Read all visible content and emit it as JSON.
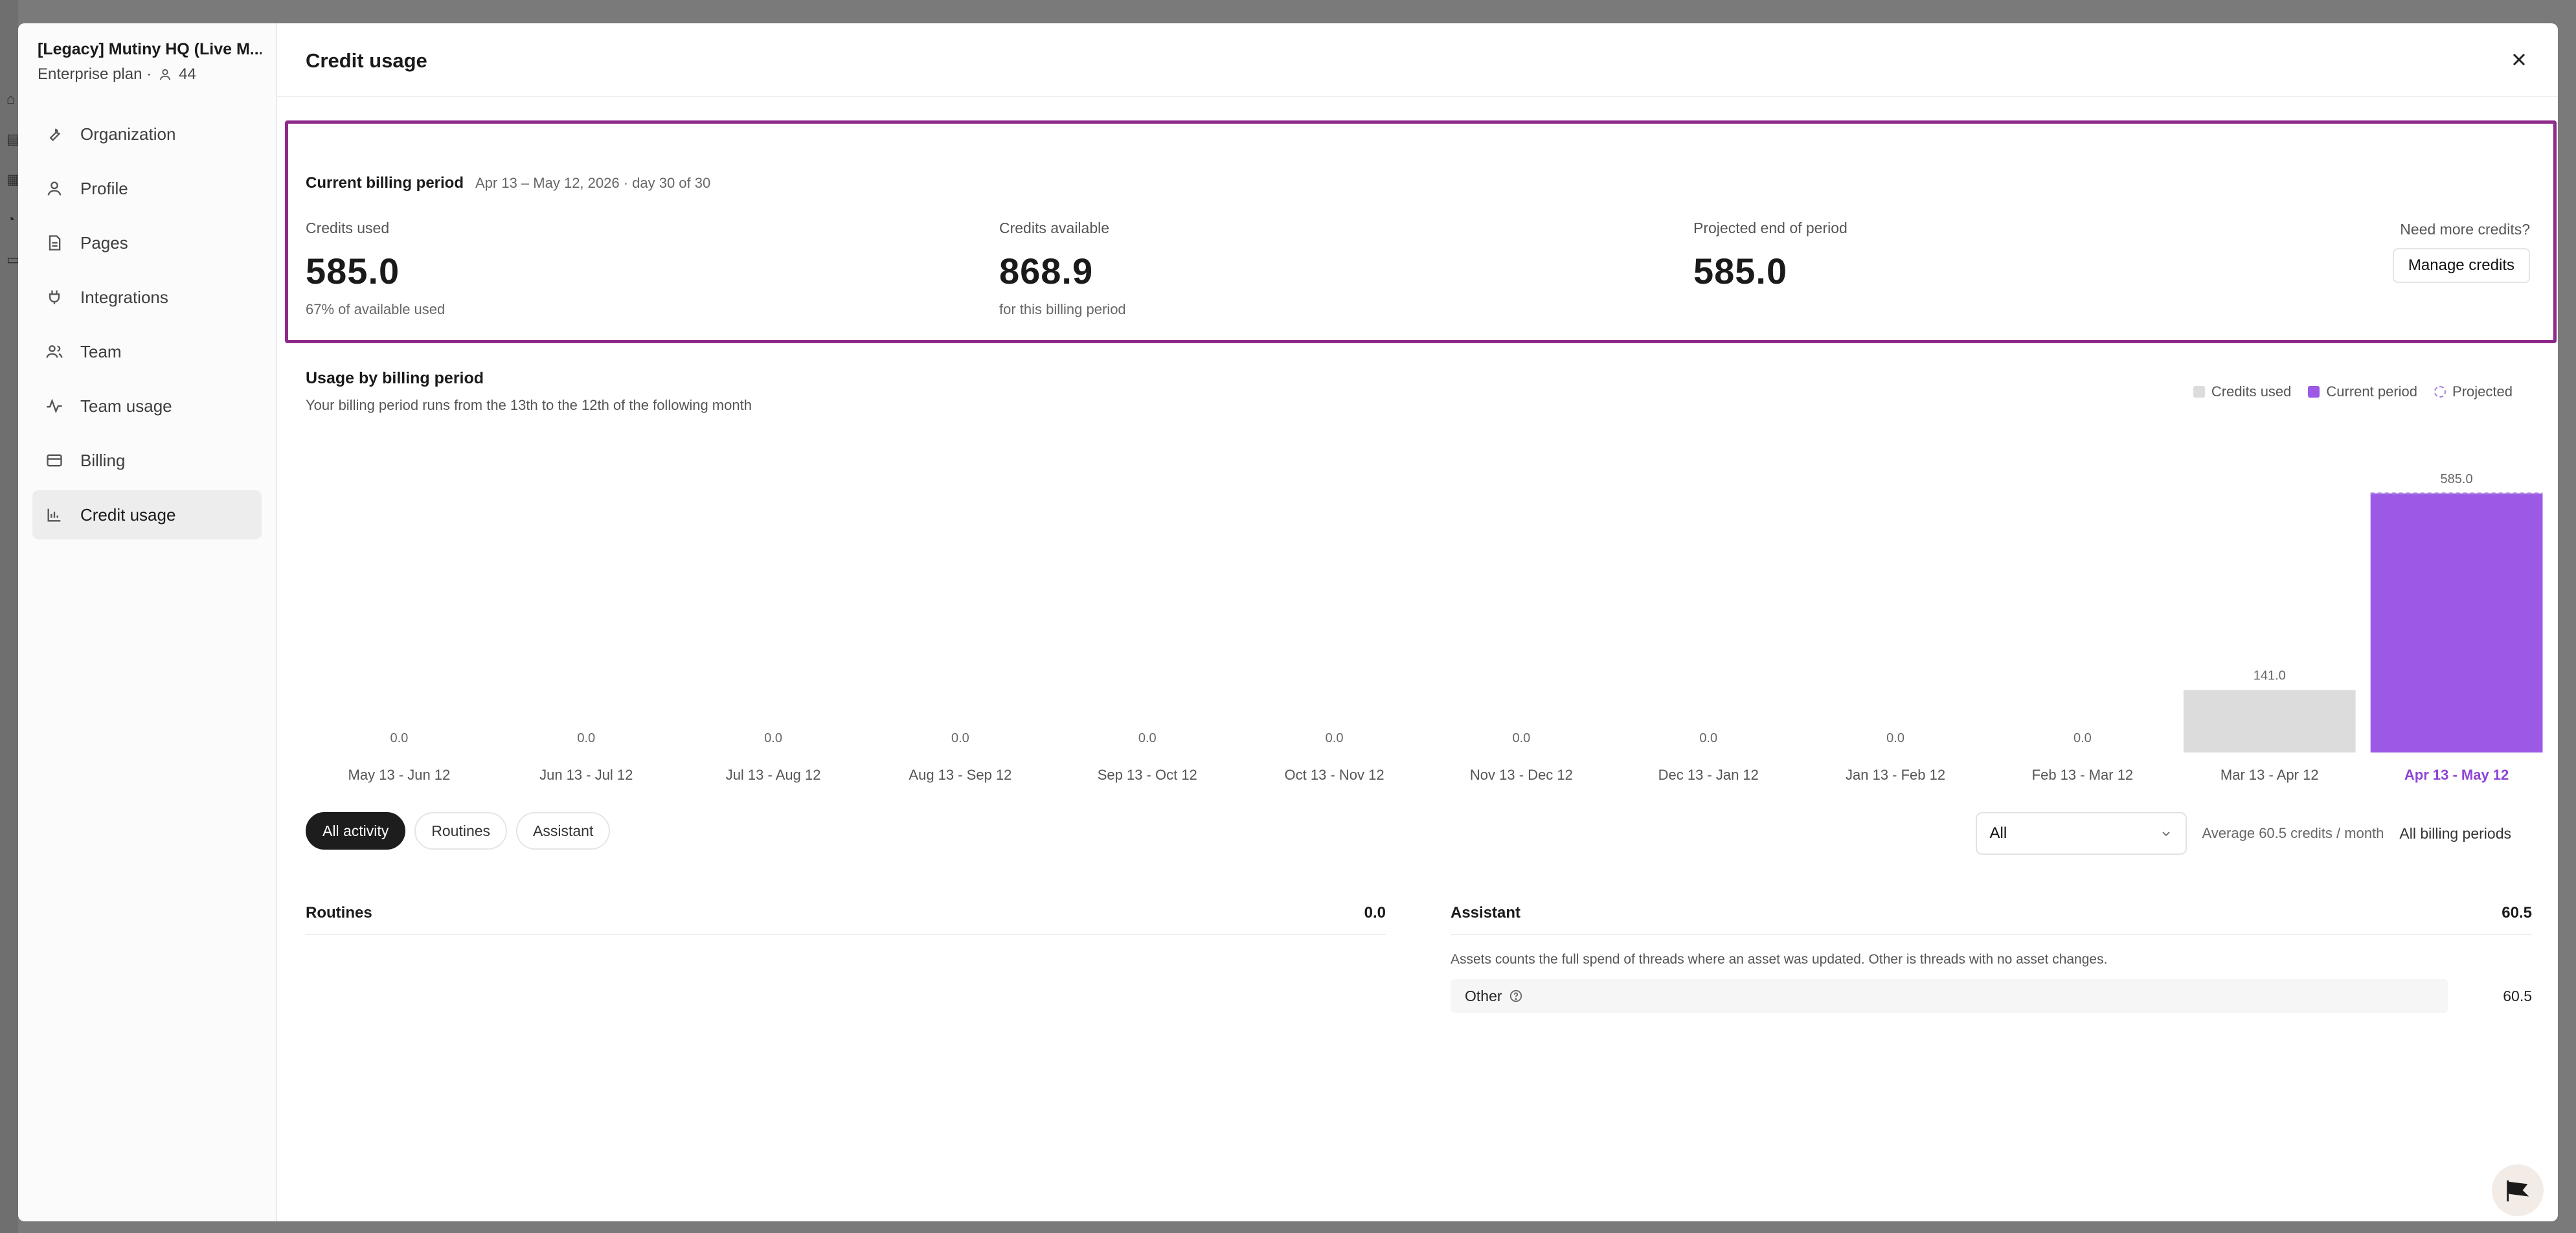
{
  "sidebar": {
    "org_name": "[Legacy] Mutiny HQ (Live M...",
    "plan": "Enterprise plan ·",
    "member_count": "44",
    "items": [
      {
        "label": "Organization",
        "icon": "wrench-icon"
      },
      {
        "label": "Profile",
        "icon": "user-icon"
      },
      {
        "label": "Pages",
        "icon": "page-icon"
      },
      {
        "label": "Integrations",
        "icon": "plug-icon"
      },
      {
        "label": "Team",
        "icon": "users-icon"
      },
      {
        "label": "Team usage",
        "icon": "activity-icon"
      },
      {
        "label": "Billing",
        "icon": "card-icon"
      },
      {
        "label": "Credit usage",
        "icon": "bar-chart-icon",
        "active": true
      }
    ]
  },
  "header": {
    "title": "Credit usage"
  },
  "billing": {
    "title": "Current billing period",
    "range": "Apr 13 – May 12, 2026 · day 30 of 30",
    "credits_used_label": "Credits used",
    "credits_used_value": "585.0",
    "credits_used_sub": "67% of available used",
    "credits_available_label": "Credits available",
    "credits_available_value": "868.9",
    "credits_available_sub": "for this billing period",
    "projected_label": "Projected end of period",
    "projected_value": "585.0",
    "need_more": "Need more credits?",
    "manage_label": "Manage credits",
    "highlight_color": "#8e2a8c"
  },
  "usage": {
    "title": "Usage by billing period",
    "subtitle": "Your billing period runs from the 13th to the 12th of the following month",
    "legend": [
      "Credits used",
      "Current period",
      "Projected"
    ]
  },
  "chart_data": {
    "type": "bar",
    "title": "Usage by billing period",
    "categories": [
      "May 13 - Jun 12",
      "Jun 13 - Jul 12",
      "Jul 13 - Aug 12",
      "Aug 13 - Sep 12",
      "Sep 13 - Oct 12",
      "Oct 13 - Nov 12",
      "Nov 13 - Dec 12",
      "Dec 13 - Jan 12",
      "Jan 13 - Feb 12",
      "Feb 13 - Mar 12",
      "Mar 13 - Apr 12",
      "Apr 13 - May 12"
    ],
    "values": [
      0.0,
      0.0,
      0.0,
      0.0,
      0.0,
      0.0,
      0.0,
      0.0,
      0.0,
      0.0,
      141.0,
      585.0
    ],
    "value_labels": [
      "0.0",
      "0.0",
      "0.0",
      "0.0",
      "0.0",
      "0.0",
      "0.0",
      "0.0",
      "0.0",
      "0.0",
      "141.0",
      "585.0"
    ],
    "current_index": 11,
    "ylim": [
      0,
      585
    ],
    "grid": false,
    "legend_position": "top-right",
    "colors": {
      "used": "#dcdcdc",
      "current": "#9b59e6",
      "current_label": "#8e44d6",
      "projected": "#a87ee0"
    }
  },
  "activity": {
    "tabs": [
      "All activity",
      "Routines",
      "Assistant"
    ],
    "filter_value": "All",
    "average": "Average 60.5 credits / month",
    "all_periods": "All billing periods",
    "routines_label": "Routines",
    "routines_value": "0.0",
    "assistant_label": "Assistant",
    "assistant_value": "60.5",
    "assistant_note": "Assets counts the full spend of threads where an asset was updated. Other is threads with no asset changes.",
    "other_label": "Other",
    "other_value": "60.5"
  }
}
